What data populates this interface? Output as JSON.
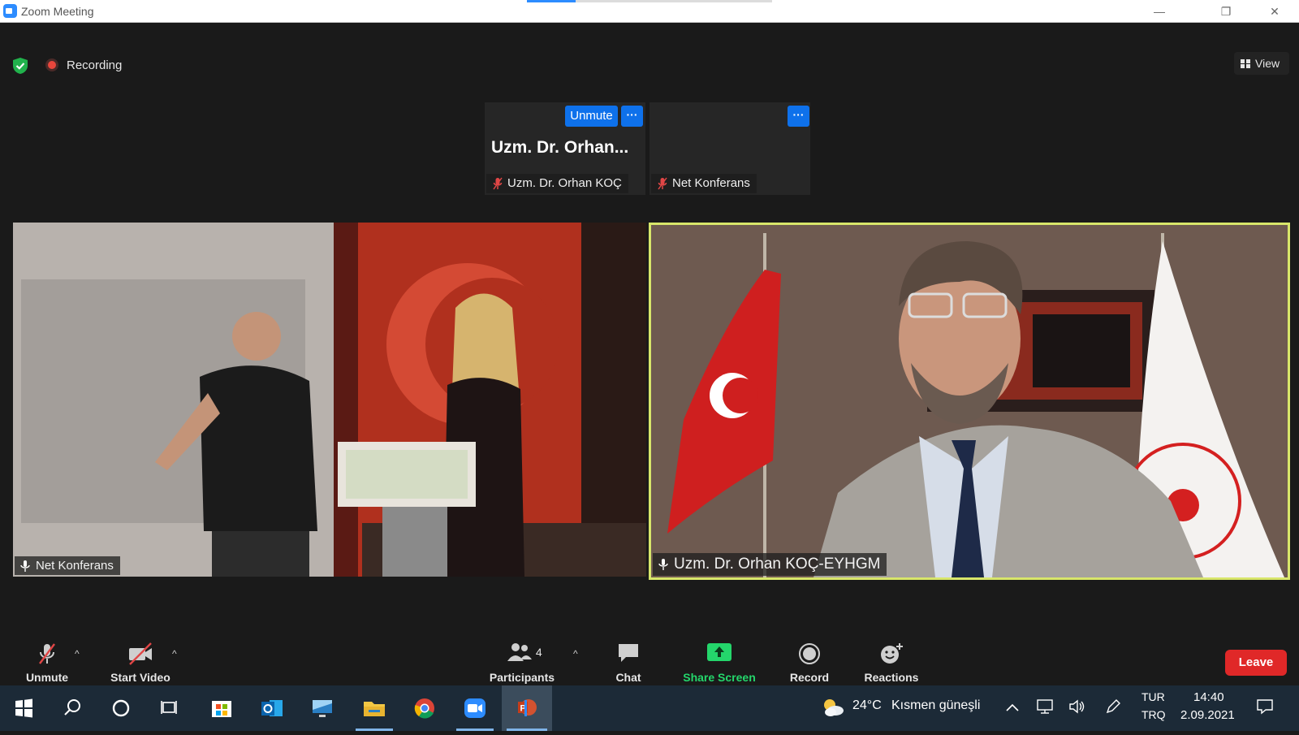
{
  "window": {
    "title": "Zoom Meeting",
    "progress_fraction": 0.2,
    "minimize_glyph": "—",
    "restore_glyph": "❐",
    "close_glyph": "✕"
  },
  "top_bar": {
    "recording_label": "Recording",
    "view_label": "View",
    "security_icon": "shield-check-icon"
  },
  "thumbnails": [
    {
      "display_name": "Uzm. Dr. Orhan...",
      "unmute_label": "Unmute",
      "more_glyph": "···",
      "nametag": "Uzm. Dr. Orhan KOÇ",
      "audio": "muted"
    },
    {
      "display_name": "",
      "more_glyph": "···",
      "nametag": "Net Konferans",
      "audio": "muted"
    }
  ],
  "videos": [
    {
      "nametag": "Net Konferans",
      "audio_icon": "speaking-icon"
    },
    {
      "nametag": "Uzm. Dr. Orhan KOÇ-EYHGM",
      "audio_icon": "speaking-icon",
      "active_speaker": true,
      "highlight_color": "#d8e66a"
    }
  ],
  "toolbar": {
    "unmute_label": "Unmute",
    "start_video_label": "Start Video",
    "participants_label": "Participants",
    "participants_count": "4",
    "chat_label": "Chat",
    "share_screen_label": "Share Screen",
    "record_label": "Record",
    "reactions_label": "Reactions",
    "leave_label": "Leave",
    "caret_glyph": "^"
  },
  "taskbar": {
    "apps": [
      "windows-start-icon",
      "search-icon",
      "cortana-icon",
      "task-view-icon",
      "store-icon",
      "outlook-icon",
      "remote-desktop-icon",
      "file-explorer-icon",
      "chrome-icon",
      "zoom-icon",
      "powerpoint-icon"
    ],
    "weather_temp": "24°C",
    "weather_text": "Kısmen güneşli",
    "lang_top": "TUR",
    "lang_bottom": "TRQ",
    "time": "14:40",
    "date": "2.09.2021"
  },
  "colors": {
    "accent_blue": "#0e71eb",
    "leave_red": "#e02828",
    "share_green": "#24d66b",
    "recording_red": "#e8463c"
  }
}
